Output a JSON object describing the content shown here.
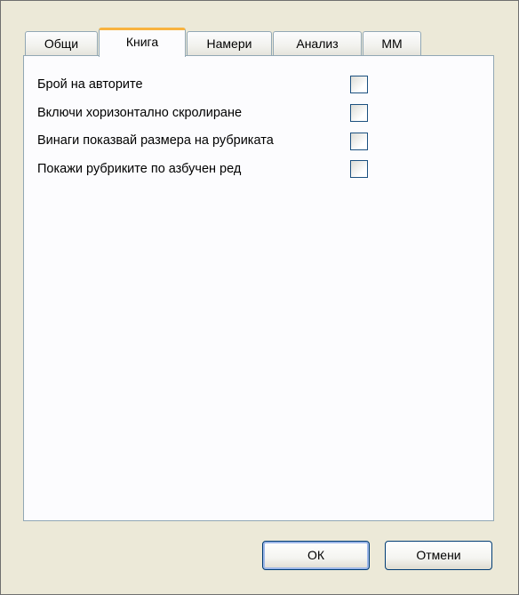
{
  "tabs": [
    {
      "label": "Общи",
      "active": false
    },
    {
      "label": "Книга",
      "active": true
    },
    {
      "label": "Намери",
      "active": false
    },
    {
      "label": "Анализ",
      "active": false
    },
    {
      "label": "ММ",
      "active": false
    }
  ],
  "options": [
    {
      "label": "Брой на авторите",
      "checked": false
    },
    {
      "label": "Включи хоризонтално скролиране",
      "checked": false
    },
    {
      "label": "Винаги показвай размера на рубриката",
      "checked": false
    },
    {
      "label": "Покажи рубриките по азбучен ред",
      "checked": false
    }
  ],
  "buttons": {
    "ok_label": "ОК",
    "cancel_label": "Отмени"
  },
  "colors": {
    "dialog_background": "#ece9d8",
    "panel_background": "#fcfcfe",
    "active_tab_accent": "#f8b33f",
    "tab_border": "#91a7b4",
    "checkbox_border": "#1c5180",
    "button_border": "#003c74"
  }
}
